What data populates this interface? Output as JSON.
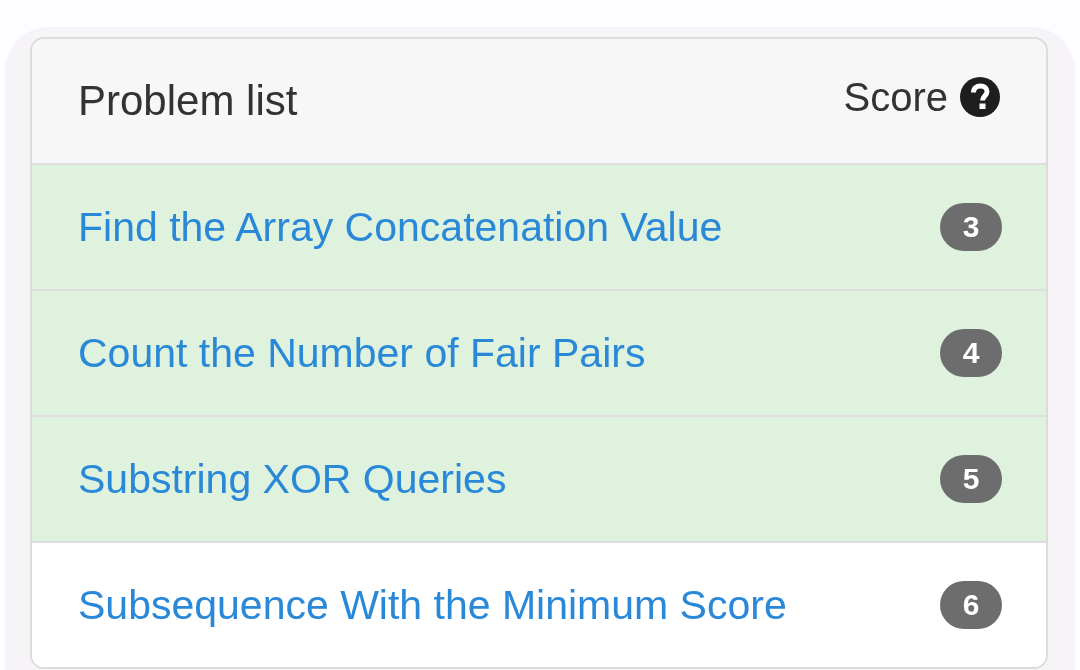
{
  "header": {
    "title": "Problem list",
    "score_label": "Score"
  },
  "problems": [
    {
      "title": "Find the Array Concatenation Value",
      "score": "3",
      "solved": true
    },
    {
      "title": "Count the Number of Fair Pairs",
      "score": "4",
      "solved": true
    },
    {
      "title": "Substring XOR Queries",
      "score": "5",
      "solved": true
    },
    {
      "title": "Subsequence With the Minimum Score",
      "score": "6",
      "solved": false
    }
  ]
}
